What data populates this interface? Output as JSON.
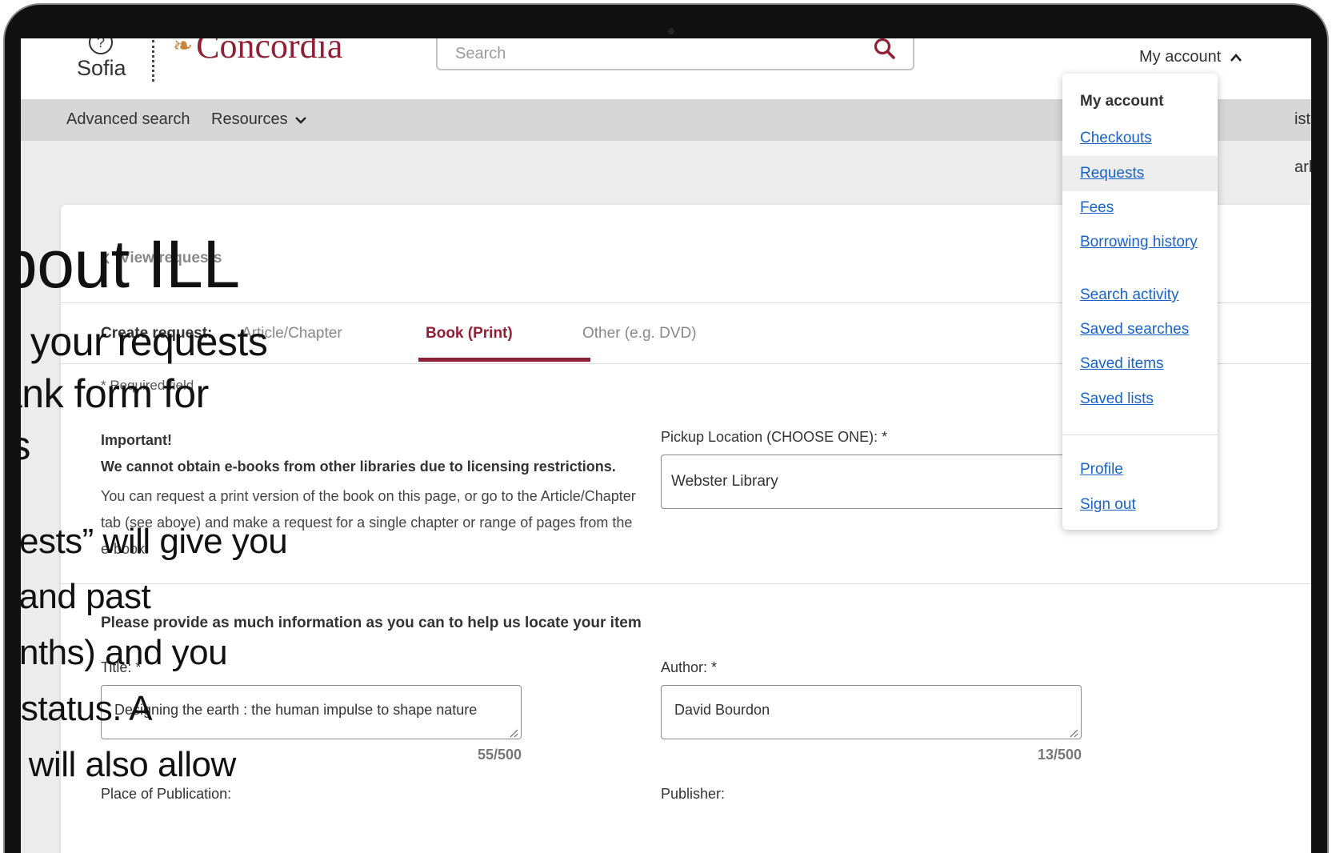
{
  "header": {
    "sofia_logo_text": "Sofia",
    "concordia_logo_text": "Concordia",
    "search_placeholder": "Search",
    "account_label": "My account"
  },
  "nav": {
    "advanced_search": "Advanced search",
    "resources": "Resources",
    "partial_right": "ist",
    "partial_bg": "arl"
  },
  "request_form": {
    "back_link": "View requests",
    "tabs_label": "Create request:",
    "tabs": [
      {
        "label": "Article/Chapter",
        "active": false
      },
      {
        "label": "Book (Print)",
        "active": true
      },
      {
        "label": "Other (e.g. DVD)",
        "active": false
      }
    ],
    "required_note": "* Required field",
    "important_title": "Important!",
    "important_bold": "We cannot obtain e-books from other libraries due to licensing restrictions.",
    "important_body": "You can request a print version of the book on this page, or go to the Article/Chapter tab (see above) and make a request for a single chapter or range of pages from the e-book.",
    "pickup_label": "Pickup Location (CHOOSE ONE): *",
    "pickup_value": "Webster Library",
    "section_title": "Please provide as much information as you can to help us locate your item",
    "title_label": "Title: *",
    "title_value": "Designing the earth : the human impulse to shape nature",
    "title_counter": "55/500",
    "author_label": "Author: *",
    "author_value": "David Bourdon",
    "author_counter": "13/500",
    "place_label": "Place of Publication:",
    "publisher_label": "Publisher:"
  },
  "account_menu": {
    "heading": "My account",
    "items": [
      "Checkouts",
      "Requests",
      "Fees",
      "Borrowing history",
      "Search activity",
      "Saved searches",
      "Saved items",
      "Saved lists",
      "Profile",
      "Sign out"
    ],
    "hovered_item": "Requests"
  },
  "overlay_text": {
    "heading": "bout ILL",
    "lines": [
      "s your requests",
      "ank form for",
      "ts",
      "uests” will give you",
      "t and past",
      "onths) and you",
      "r status. A",
      "n will also allow"
    ]
  },
  "colors": {
    "brand": "#8f2035",
    "link": "#1a63c4",
    "navbar": "#d6d6d6",
    "page_bg": "#ececec"
  }
}
